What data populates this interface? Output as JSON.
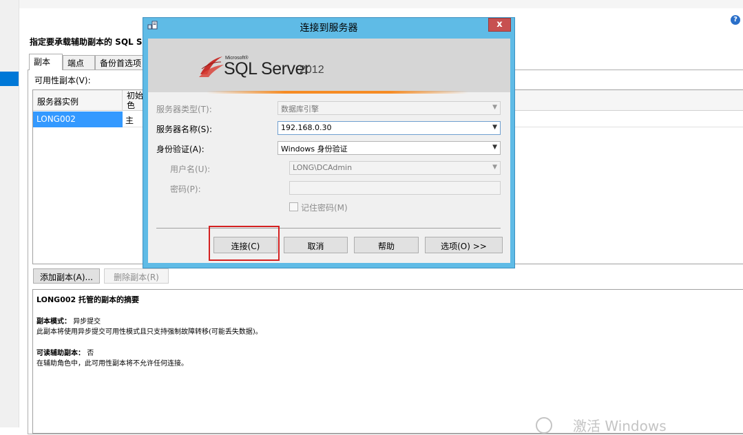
{
  "wizard": {
    "heading": "指定要承载辅助副本的 SQL Se",
    "help_icon": "?",
    "tabs": [
      {
        "label": "副本"
      },
      {
        "label": "端点"
      },
      {
        "label": "备份首选项"
      }
    ],
    "availability_label": "可用性副本(V):",
    "grid": {
      "columns": [
        "服务器实例",
        "初始\n色"
      ],
      "rows": [
        {
          "server": "LONG002",
          "role": "主"
        }
      ]
    },
    "add_replica_label": "添加副本(A)...",
    "remove_replica_label": "删除副本(R)",
    "summary": {
      "title": "LONG002 托管的副本的摘要",
      "mode_title": "副本模式：",
      "mode_value": "异步提交",
      "mode_desc": "此副本将使用异步提交可用性模式且只支持强制故障转移(可能丢失数据)。",
      "readable_title": "可读辅助副本：",
      "readable_value": "否",
      "readable_desc": "在辅助角色中，此可用性副本将不允许任何连接。"
    },
    "watermark": "激活 Windows"
  },
  "dialog": {
    "title": "连接到服务器",
    "close_label": "x",
    "logo": {
      "small": "Microsoft®",
      "main": "SQL Server",
      "year": "2012"
    },
    "server_type": {
      "label": "服务器类型(T):",
      "value": "数据库引擎"
    },
    "server_name": {
      "label": "服务器名称(S):",
      "value": "192.168.0.30"
    },
    "auth": {
      "label": "身份验证(A):",
      "value": "Windows 身份验证"
    },
    "username": {
      "label": "用户名(U):",
      "value": "LONG\\DCAdmin"
    },
    "password": {
      "label": "密码(P):",
      "value": ""
    },
    "remember_password": "记住密码(M)",
    "buttons": {
      "connect": "连接(C)",
      "cancel": "取消",
      "help": "帮助",
      "options": "选项(O) >>"
    }
  }
}
